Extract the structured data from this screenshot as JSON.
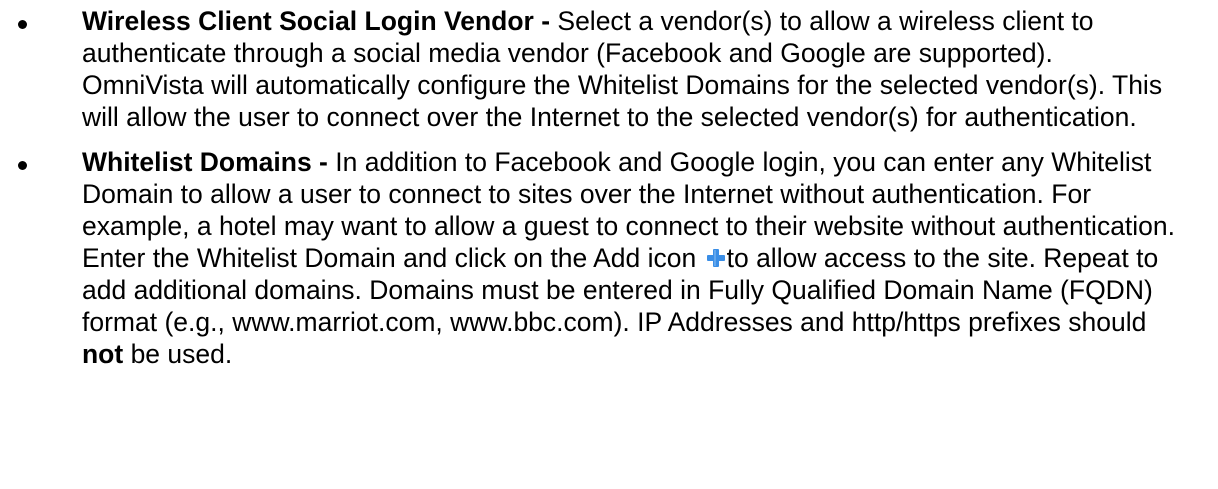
{
  "items": [
    {
      "term": "Wireless Client Social Login Vendor -",
      "text": " Select a vendor(s) to allow a wireless client to authenticate through a social media vendor (Facebook and Google are supported). OmniVista will automatically configure the Whitelist Domains for the selected vendor(s). This will allow the user to connect over the Internet to the selected vendor(s) for authentication."
    },
    {
      "term": "Whitelist Domains -",
      "text_before_icon": " In addition to Facebook and Google login, you can enter any Whitelist Domain to allow a user to connect to sites over the Internet without authentication. For example, a hotel may want to allow a guest to connect to their website without authentication. Enter the Whitelist Domain and click on the Add icon ",
      "icon": "add-plus-icon",
      "text_after_icon": "to allow access to the site. Repeat to add additional domains. Domains must be entered in Fully Qualified Domain Name (FQDN) format (e.g., www.marriot.com, www.bbc.com). IP Addresses and http/https prefixes should ",
      "emphasis": "not",
      "text_end": " be used."
    }
  ],
  "colors": {
    "text": "#000000",
    "icon_plus": "#3a8ee6"
  }
}
